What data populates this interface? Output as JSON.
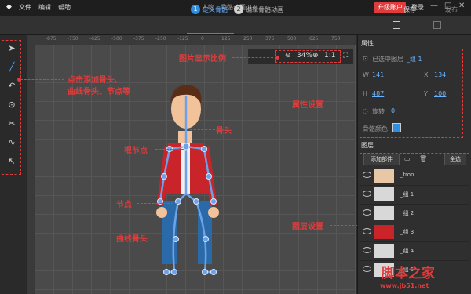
{
  "menu": {
    "file": "文件",
    "edit": "编辑",
    "help": "帮助",
    "doc_title": "人物 - 骨骼动画 0.0",
    "upgrade": "升级账户",
    "login": "登录",
    "win_min": "—",
    "win_max": "□",
    "win_close": "✕"
  },
  "toolbar": {
    "step1_num": "1",
    "step1_label": "定义骨骼",
    "step2_num": "2",
    "step2_label": "编辑骨骼动画",
    "save": "保存",
    "publish": "发布"
  },
  "ruler": {
    "ticks": [
      "-875",
      "-750",
      "-625",
      "-500",
      "-375",
      "-250",
      "-125",
      "0",
      "125",
      "250",
      "375",
      "500",
      "625",
      "750"
    ]
  },
  "zoom": {
    "value": "34%",
    "one_to_one": "1:1"
  },
  "annotations": {
    "zoom_ratio": "图片显示比例",
    "tools": "点击添加骨头、\n曲线骨头、节点等",
    "bone": "骨头",
    "root_node": "根节点",
    "node": "节点",
    "curve_bone": "曲线骨头",
    "properties": "属性设置",
    "layers": "图层设置"
  },
  "properties": {
    "title": "属性",
    "selection_label": "已选中图层",
    "selection_value": "_组 1",
    "w_label": "W",
    "w_value": "141",
    "x_label": "X",
    "x_value": "134",
    "h_label": "H",
    "h_value": "487",
    "y_label": "Y",
    "y_value": "100",
    "rotate_label": "旋转",
    "rotate_value": "0",
    "bone_color_label": "骨骼颜色"
  },
  "layers": {
    "title": "图层",
    "add_part": "添加部件",
    "select_all": "全选",
    "items": [
      {
        "name": "_fron..."
      },
      {
        "name": "_组 1"
      },
      {
        "name": "_组 2"
      },
      {
        "name": "_组 3"
      },
      {
        "name": "_组 4"
      },
      {
        "name": "_组 5"
      }
    ]
  },
  "watermark": {
    "logo": "脚本之家",
    "url": "www.jb51.net"
  },
  "colors": {
    "accent": "#2e8fe0",
    "annotation": "#e03c3c",
    "bone": "#6ea2e8"
  }
}
